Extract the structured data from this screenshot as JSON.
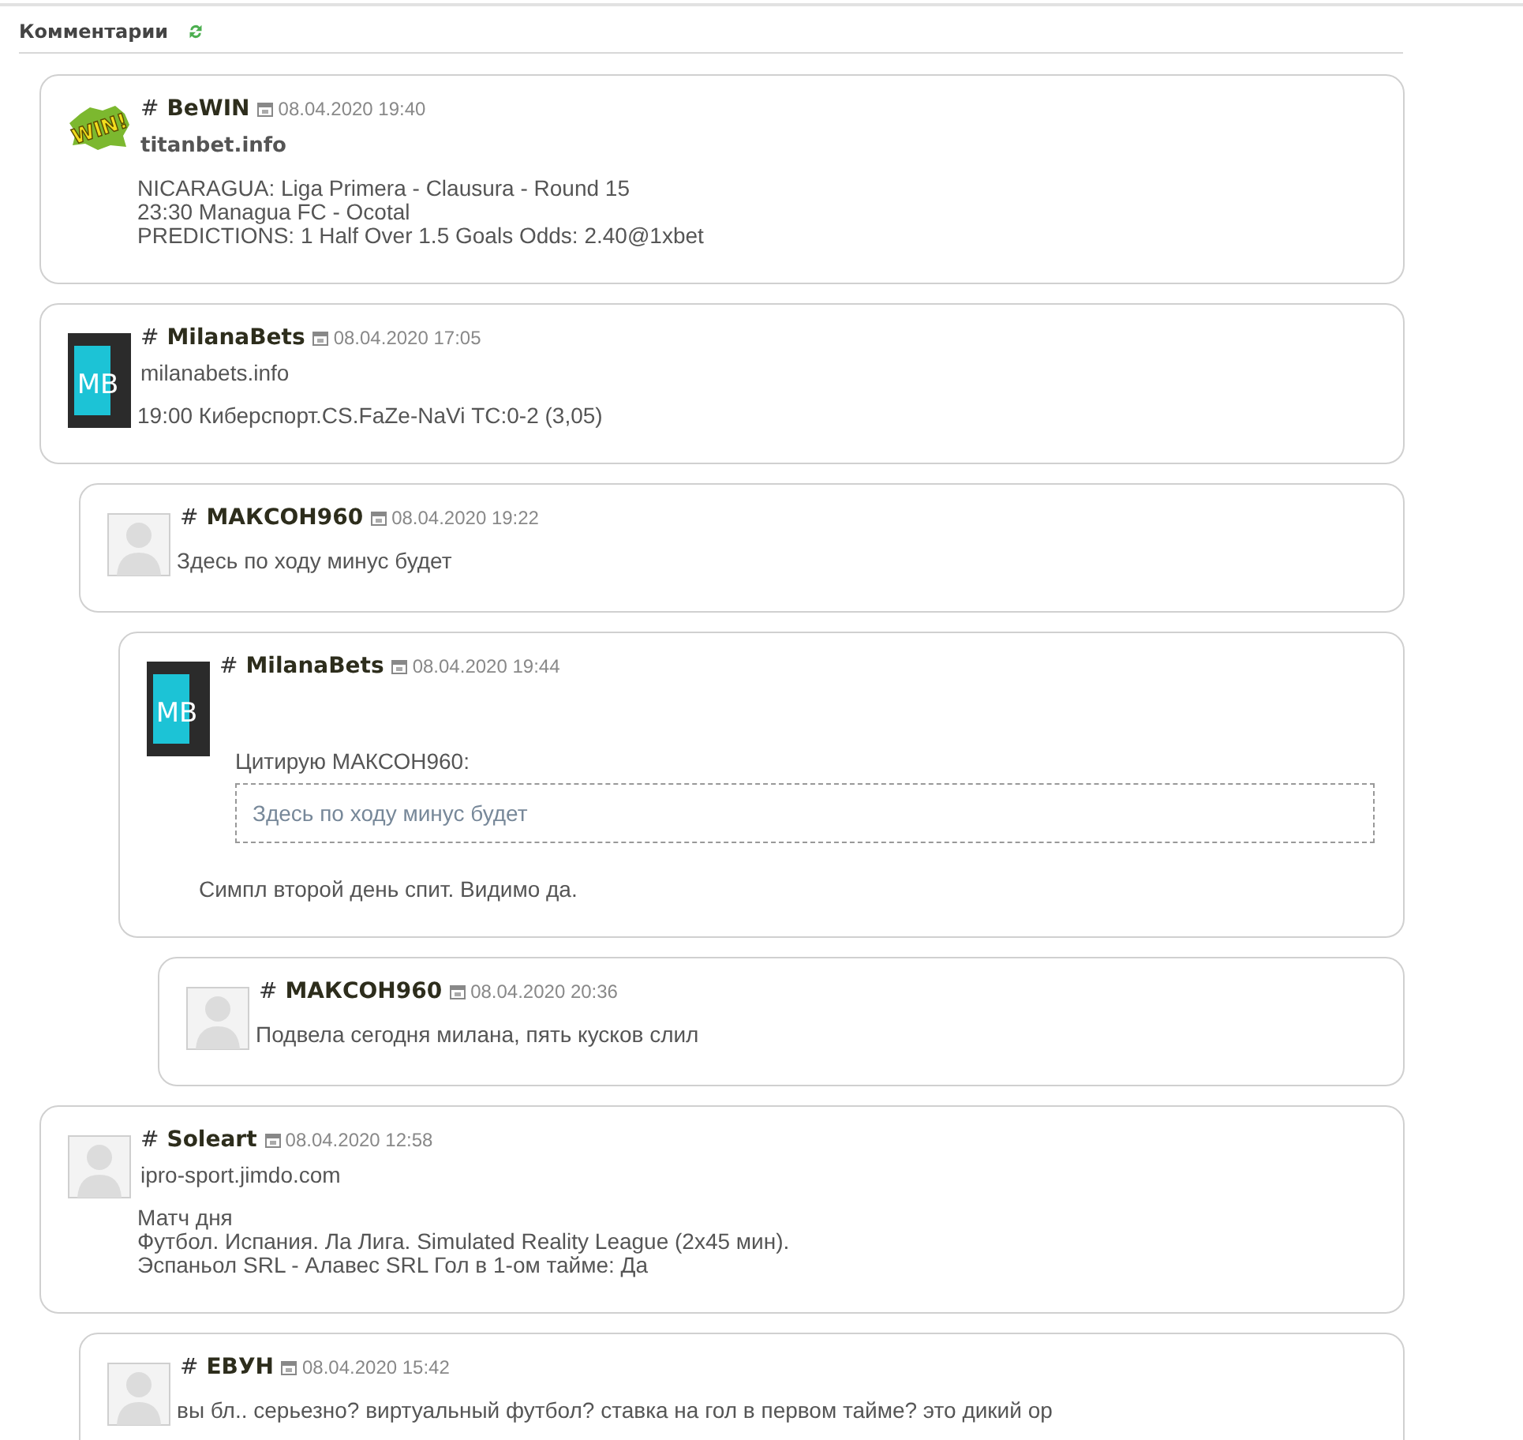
{
  "section": {
    "title": "Комментарии"
  },
  "comments": [
    {
      "avatar": {
        "kind": "win",
        "text": "WIN!"
      },
      "anchor": "#",
      "name": "BeWIN",
      "date": "08.04.2020 19:40",
      "site": {
        "text": "titanbet.info",
        "bold": true
      },
      "body": [
        {
          "kind": "paragraph",
          "lines": [
            "NICARAGUA: Liga Primera - Clausura - Round 15",
            "23:30 Managua FC - Ocotal",
            "PREDICTIONS: 1 Half Over 1.5 Goals Odds: 2.40@1xbet"
          ]
        }
      ]
    },
    {
      "avatar": {
        "kind": "mb",
        "text": "MB"
      },
      "anchor": "#",
      "name": "MilanaBets",
      "date": "08.04.2020 17:05",
      "site": {
        "text": "milanabets.info",
        "bold": false
      },
      "body": [
        {
          "kind": "paragraph",
          "lines": [
            "19:00 Киберспорт.CS.FaZe-NaVi ТС:0-2 (3,05)"
          ]
        }
      ],
      "children": [
        {
          "avatar": {
            "kind": "default"
          },
          "anchor": "#",
          "name": "МАКСОН960",
          "date": "08.04.2020 19:22",
          "body": [
            {
              "kind": "paragraph",
              "lines": [
                "Здесь по ходу минус будет"
              ]
            }
          ],
          "children": [
            {
              "avatar": {
                "kind": "mb",
                "text": "MB"
              },
              "anchor": "#",
              "name": "MilanaBets",
              "date": "08.04.2020 19:44",
              "body": [
                {
                  "kind": "quote",
                  "label": "Цитирую МАКСОН960:",
                  "text": "Здесь по ходу минус будет"
                },
                {
                  "kind": "paragraph",
                  "lines": [
                    "Симпл второй день спит. Видимо да."
                  ]
                }
              ],
              "children": [
                {
                  "avatar": {
                    "kind": "default"
                  },
                  "anchor": "#",
                  "name": "МАКСОН960",
                  "date": "08.04.2020 20:36",
                  "body": [
                    {
                      "kind": "paragraph",
                      "lines": [
                        "Подвела сегодня милана, пять кусков слил"
                      ]
                    }
                  ]
                }
              ]
            }
          ]
        }
      ]
    },
    {
      "avatar": {
        "kind": "default"
      },
      "anchor": "#",
      "name": "Soleart",
      "date": "08.04.2020 12:58",
      "site": {
        "text": "ipro-sport.jimdo.com",
        "bold": false
      },
      "body": [
        {
          "kind": "paragraph",
          "lines": [
            "Матч дня",
            "Футбол. Испания. Ла Лига. Simulated Reality League (2x45 мин).",
            "Эспаньол SRL - Алавес SRL Гол в 1-ом тайме: Да"
          ]
        }
      ],
      "children": [
        {
          "avatar": {
            "kind": "default"
          },
          "anchor": "#",
          "name": "ЕВУН",
          "date": "08.04.2020 15:42",
          "body": [
            {
              "kind": "paragraph",
              "lines": [
                "вы бл.. серьезно? виртуальный футбол? ставка на гол в первом тайме? это дикий ор"
              ]
            }
          ]
        }
      ]
    }
  ]
}
